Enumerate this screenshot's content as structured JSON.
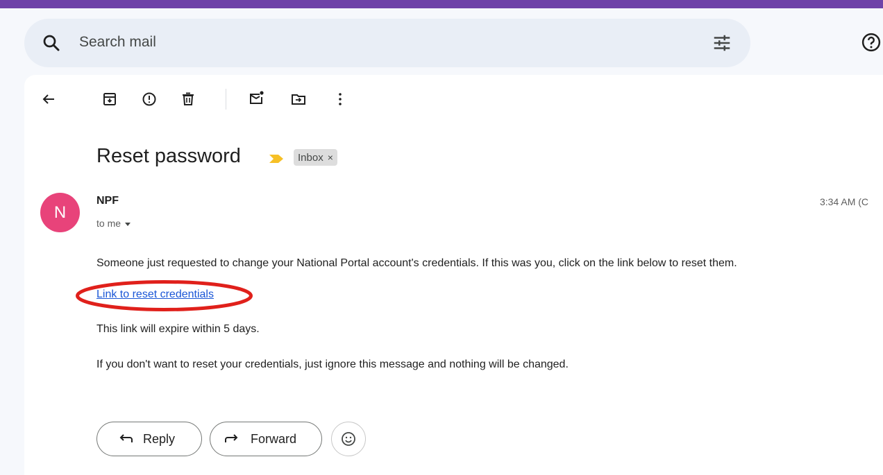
{
  "search": {
    "placeholder": "Search mail"
  },
  "message": {
    "subject": "Reset password",
    "label": "Inbox",
    "label_remove": "×",
    "avatar_letter": "N",
    "sender": "NPF",
    "recipient": "to me",
    "time": "3:34 AM (C",
    "body_line1": "Someone just requested to change your National Portal account's credentials. If this was you, click on the link below to reset them.",
    "link_text": "Link to reset credentials",
    "body_line2": "This link will expire within 5 days.",
    "body_line3": "If you don't want to reset your credentials, just ignore this message and nothing will be changed."
  },
  "actions": {
    "reply": "Reply",
    "forward": "Forward"
  },
  "colors": {
    "top_bar": "#6f42a8",
    "avatar": "#e8437a",
    "link": "#1a56d6",
    "annotation": "#e0201b",
    "importance_marker": "#f6c026"
  }
}
